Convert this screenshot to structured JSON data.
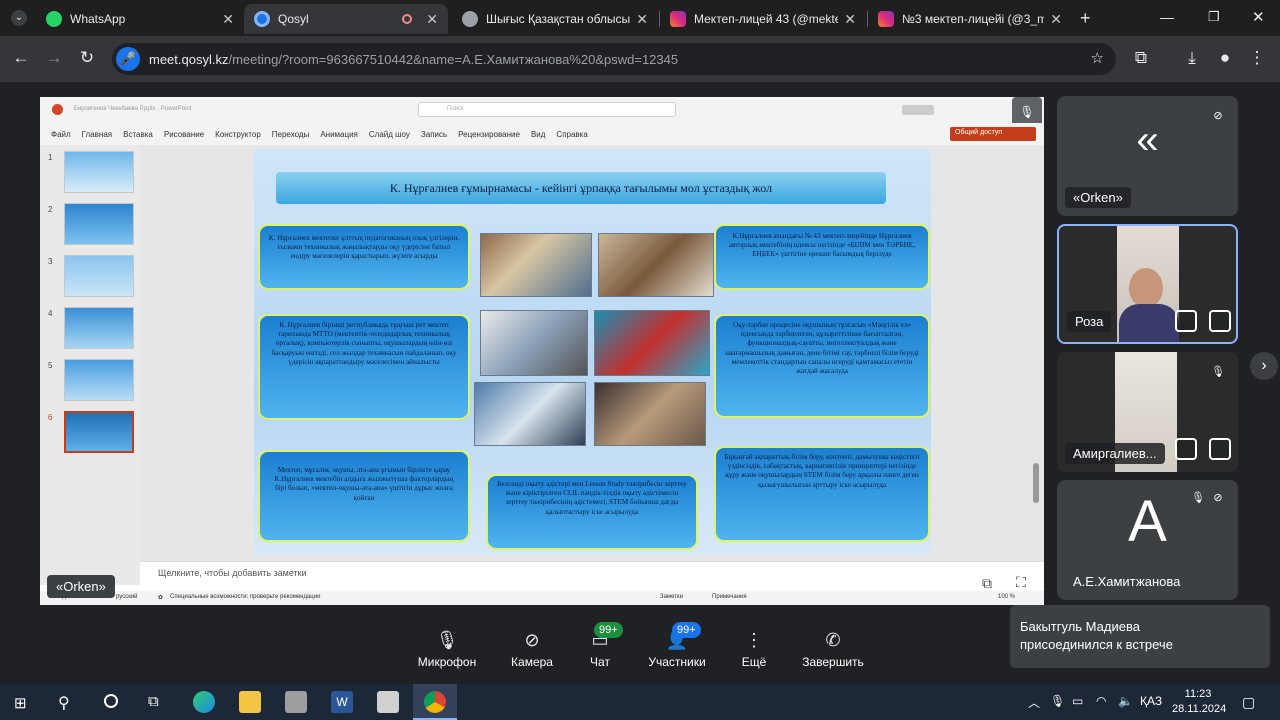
{
  "browser": {
    "tabs": [
      {
        "title": "WhatsApp",
        "active": false
      },
      {
        "title": "Qosyl",
        "active": true
      },
      {
        "title": "Шығыс Қазақстан облысы",
        "active": false
      },
      {
        "title": "Мектеп-лицей 43 (@mekte",
        "active": false
      },
      {
        "title": "№3 мектеп-лицейі (@3_m",
        "active": false
      }
    ],
    "new_tab": "+",
    "url_host": "meet.qosyl.kz",
    "url_path": "/meeting/?room=963667510442&name=А.Е.Хамитжанова%20&pswd=12345"
  },
  "presentation": {
    "window_title": "Бирлигенов Чекебаева Р.pptx  ·  PowerPoint",
    "search_placeholder": "Поиск",
    "menu": [
      "Файл",
      "Главная",
      "Вставка",
      "Рисование",
      "Конструктор",
      "Переходы",
      "Анимация",
      "Слайд шоу",
      "Запись",
      "Рецензирование",
      "Вид",
      "Справка"
    ],
    "share_button": "Общий доступ",
    "slide_numbers": [
      "1",
      "2",
      "3",
      "4",
      "5",
      "6"
    ],
    "slide_title": "К. Нұрғалиев ғұмырнамасы - кейінгі ұрпаққа тағылымы  мол ұстаздық жол",
    "boxes": [
      "К. Нұрғалиев мектепке ұлттық педагогиканың озық үлгілерін, ғылыми техникалық жаңалықтарды оқу үдерісіне батыл ендіру мәселелерін қарастырып, жүзеге асырды",
      "К. Нұрғалиев бірінші республикада тұңғыш рет мектеп тарихында МТТО (мектептік-теледидарлық техникалық орталық), компьютерлік сыныпты, оқушылардың өзін-өзі басқаруын енгізді, сол жылдар техникасын пайдаланып, оқу үдерісін ақпараттандыру мәселесімен айналысты",
      "Мектеп, мұғалім, оқушы, ата-ана ұғымын  бірлікте қарау К.Нұрғалиев мектебін алдыға жылжытушы факторлардың бірі  болып, «мектеп-оқушы-ата-ана» үштігін  дұрыс жолға қойған",
      "Белсенді оқыту әдістері мен Lesson Study тәжірибесін зерттеу және кіріктірілген CLIL пәндік-тілдік оқыту әдістемесін зерттеу тәжірибесінің әдістемесі, STEM  бойынша дағды қалыптастыру іске асырылуда",
      "К.Нұрғалиев атындағы № 43 мектеп-лицейінде Нұрғалиев  авторлық мектебінің идеясы  негізінде «БІЛІМ мен ТӘРБИЕ, ЕҢБЕК» үштігіне ерекше басымдық берілуде",
      "Оқу-тәрбие процесіне оқушының тұлғасын «Мәңгілік ел» идеясында тәрбиелеген, құзыреттілікке бағытталған, функционалдық-сауатты, интеллектуалдық және шығармашылық дамыған, дене бітімі сау, тәрбиелі білім беруді мемлекеттік стандартын сапалы игеруді қамтамасыз ететін жағдай жасалуда",
      "Бірыңғай  ақпараттық-білім беру, контенті, дамытушы кеңістікті үздіксіздік, сабақтастық, вариативтілік принциптері негізінде құру және оқушылардың STEM білім беру арқылы пәнге деген қызығушылығын арттыру іске асырылуда"
    ],
    "notes_placeholder": "Щелкните, чтобы добавить заметки",
    "status_left": "Слайд 6 из 6",
    "status_lang": "русский",
    "status_access": "Специальные возможности: проверьте рекомендации",
    "status_notes": "Заметки",
    "status_comments": "Примечания",
    "zoom": "100 %"
  },
  "meeting": {
    "presenter_label": "«Orken»",
    "participants": [
      {
        "name": "«Orken»",
        "avatar": "«"
      },
      {
        "name": "Роза"
      },
      {
        "name": "Амиргалиев..."
      },
      {
        "name": "А.Е.Хамитжанова",
        "avatar": "A"
      }
    ],
    "controls": {
      "mic": "Микрофон",
      "camera": "Камера",
      "chat": "Чат",
      "participants": "Участники",
      "more": "Ещё",
      "end": "Завершить",
      "chat_badge": "99+",
      "participants_badge": "99+"
    },
    "toast": {
      "line1": "Бакытгуль Мадиева",
      "line2": "присоединился к встрече"
    }
  },
  "taskbar": {
    "lang": "ҚАЗ",
    "time": "11:23",
    "date": "28.11.2024"
  },
  "colors": {
    "accent": "#1a73e8",
    "badge": "#1e8e3e",
    "meet_bg": "#202124"
  }
}
